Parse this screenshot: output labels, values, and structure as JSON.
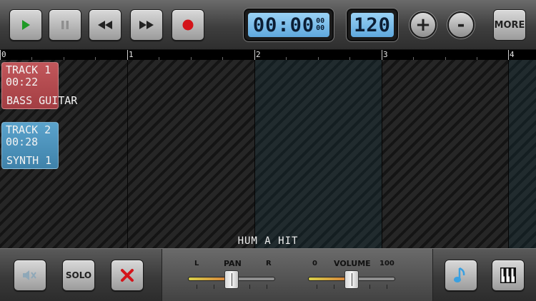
{
  "transport": {
    "play": "play-icon",
    "pause": "pause-icon",
    "rewind": "rewind-icon",
    "fast_forward": "fast-forward-icon",
    "record": "record-icon"
  },
  "time_display": {
    "main": "00:00",
    "sub_top": "00",
    "sub_bottom": "00"
  },
  "tempo_display": "120",
  "tempo_increase_label": "+",
  "tempo_decrease_label": "-",
  "more_label": "MORE",
  "ruler": {
    "marks": [
      "0",
      "1",
      "2",
      "3",
      "4"
    ]
  },
  "tracks": [
    {
      "name": "TRACK 1",
      "duration": "00:22",
      "instrument": "BASS GUITAR",
      "color": "#b8474c"
    },
    {
      "name": "TRACK 2",
      "duration": "00:28",
      "instrument": "SYNTH 1",
      "color": "#4b93bd"
    }
  ],
  "hum_label": "HUM A HIT",
  "bottom": {
    "mute": "speaker-mute-icon",
    "solo_label": "SOLO",
    "delete": "delete-x-icon",
    "pan": {
      "label": "PAN",
      "left": "L",
      "right": "R",
      "value": 0.5
    },
    "volume": {
      "label": "VOLUME",
      "min": "0",
      "max": "100",
      "value": 0.5
    },
    "music_note": "music-note-icon",
    "piano": "piano-keys-icon"
  },
  "colors": {
    "accent_blue": "#5fa8dd",
    "record_red": "#d4141a",
    "play_green": "#1e9a25"
  }
}
